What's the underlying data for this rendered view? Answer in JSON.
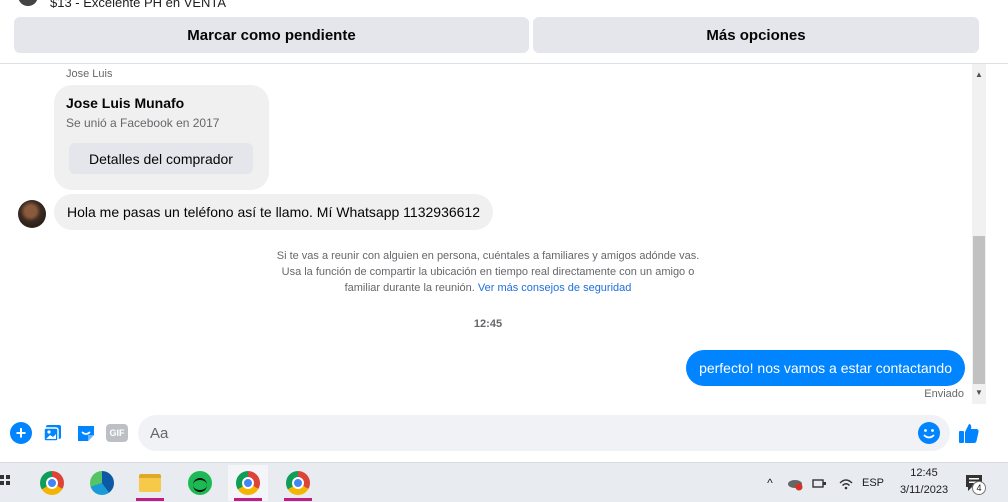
{
  "listing": {
    "title": "$13 - Excelente PH en VENTA"
  },
  "actions": {
    "mark_pending": "Marcar como pendiente",
    "more_options": "Más opciones"
  },
  "buyer": {
    "sender_label": "Jose Luis",
    "name": "Jose Luis Munafo",
    "joined": "Se unió a Facebook en 2017",
    "details_button": "Detalles del comprador"
  },
  "messages": {
    "incoming": "Hola me pasas un teléfono así te llamo. Mí Whatsapp 1132936612",
    "safety_line1": "Si te vas a reunir con alguien en persona, cuéntales a familiares y amigos adónde vas.",
    "safety_line2": "Usa la función de compartir la ubicación en tiempo real directamente con un amigo o",
    "safety_line3": "familiar durante la reunión.",
    "safety_link": "Ver más consejos de seguridad",
    "time": "12:45",
    "outgoing": "perfecto! nos vamos a estar contactando",
    "status": "Enviado"
  },
  "composer": {
    "placeholder": "Aa",
    "gif_label": "GIF",
    "plus_label": "+"
  },
  "taskbar": {
    "language": "ESP",
    "time": "12:45",
    "date": "3/11/2023",
    "notifications": "4",
    "chevron": "^"
  },
  "colors": {
    "accent": "#0084ff",
    "bubble_gray": "#f0f0f0",
    "link": "#216fdb",
    "taskbar": "#e8ebf0"
  },
  "icons": [
    "plus-icon",
    "photo-icon",
    "sticker-icon",
    "gif-icon",
    "emoji-icon",
    "like-icon",
    "chrome-icon",
    "edge-icon",
    "file-explorer-icon",
    "spotify-icon",
    "wifi-icon",
    "network-icon",
    "notification-icon"
  ]
}
